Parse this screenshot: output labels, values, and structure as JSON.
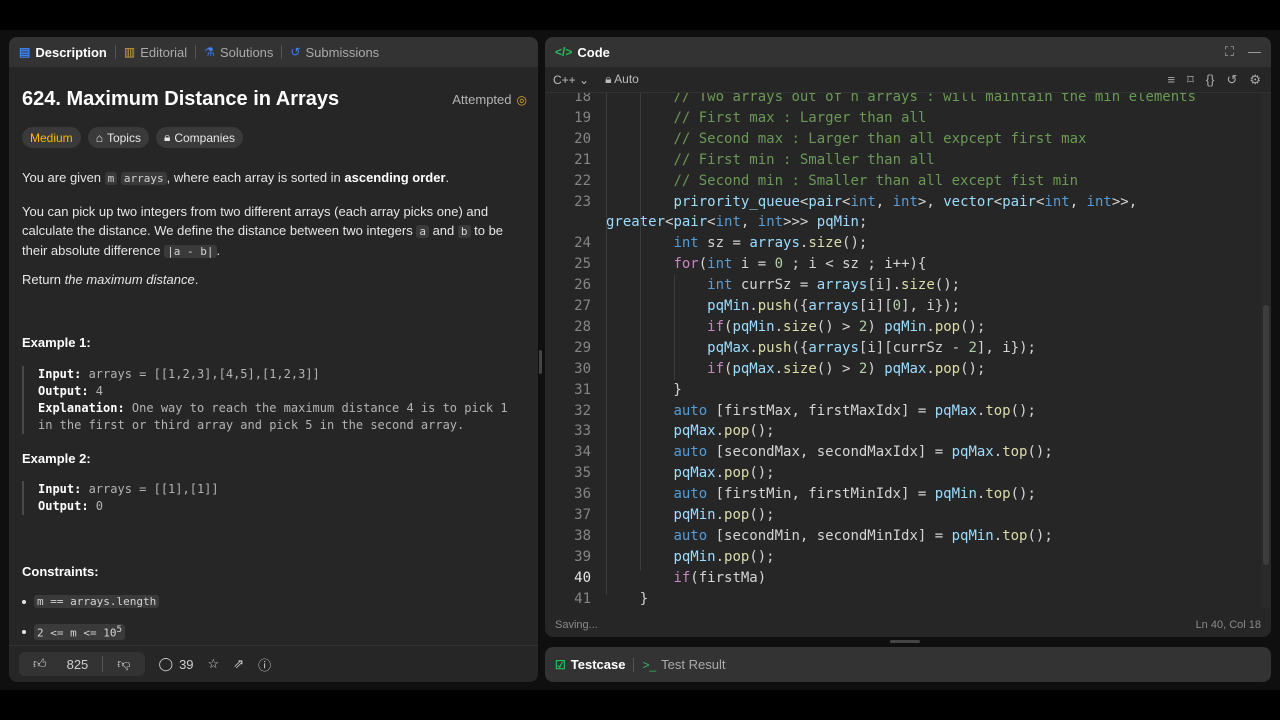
{
  "left_tabs": [
    {
      "label": "Description",
      "icon": "description-icon"
    },
    {
      "label": "Editorial",
      "icon": "book-icon"
    },
    {
      "label": "Solutions",
      "icon": "flask-icon"
    },
    {
      "label": "Submissions",
      "icon": "history-icon"
    }
  ],
  "problem": {
    "title": "624. Maximum Distance in Arrays",
    "status": "Attempted",
    "difficulty": "Medium",
    "topics_label": "Topics",
    "companies_label": "Companies",
    "p1_a": "You are given ",
    "p1_code": "m",
    "p1_b": " ",
    "p1_code2": "arrays",
    "p1_c": ", where each array is sorted in ",
    "p1_bold": "ascending order",
    "p1_d": ".",
    "p2_a": "You can pick up two integers from two different arrays (each array picks one) and calculate the distance. We define the distance between two integers ",
    "p2_code1": "a",
    "p2_b": " and ",
    "p2_code2": "b",
    "p2_c": " to be their absolute difference ",
    "p2_code3": "|a - b|",
    "p2_d": ".",
    "p3_a": "Return ",
    "p3_em": "the maximum distance",
    "p3_b": ".",
    "example1_title": "Example 1:",
    "example1_input_k": "Input:",
    "example1_input_v": " arrays = [[1,2,3],[4,5],[1,2,3]]",
    "example1_output_k": "Output:",
    "example1_output_v": " 4",
    "example1_expl_k": "Explanation:",
    "example1_expl_v1": " One way to reach the maximum distance 4 is to pick 1",
    "example1_expl_v2": "in the first or third array and pick 5 in the second array.",
    "example2_title": "Example 2:",
    "example2_input_k": "Input:",
    "example2_input_v": " arrays = [[1],[1]]",
    "example2_output_k": "Output:",
    "example2_output_v": " 0",
    "constraints_title": "Constraints:",
    "c1": "m == arrays.length",
    "c2_a": "2 <= m <= 10",
    "c2_sup": "5"
  },
  "footer": {
    "likes": "825",
    "comments": "39"
  },
  "code_panel": {
    "title": "Code",
    "language": "C++",
    "mode": "Auto",
    "status_left": "Saving...",
    "status_right": "Ln 40, Col 18"
  },
  "code_lines": [
    {
      "n": "18",
      "text": "        // Two arrays out of n arrays : will maintain the min elements"
    },
    {
      "n": "19",
      "text": "        // First max : Larger than all"
    },
    {
      "n": "20",
      "text": "        // Second max : Larger than all expcept first max"
    },
    {
      "n": "21",
      "text": "        // First min : Smaller than all"
    },
    {
      "n": "22",
      "text": "        // Second min : Smaller than all except fist min"
    },
    {
      "n": "23",
      "text": "        prirority_queue<pair<int, int>, vector<pair<int, int>>,"
    },
    {
      "n": "",
      "text": "greater<pair<int, int>>> pqMin;"
    },
    {
      "n": "24",
      "text": "        int sz = arrays.size();"
    },
    {
      "n": "25",
      "text": "        for(int i = 0 ; i < sz ; i++){"
    },
    {
      "n": "26",
      "text": "            int currSz = arrays[i].size();"
    },
    {
      "n": "27",
      "text": "            pqMin.push({arrays[i][0], i});"
    },
    {
      "n": "28",
      "text": "            if(pqMin.size() > 2) pqMin.pop();"
    },
    {
      "n": "29",
      "text": "            pqMax.push({arrays[i][currSz - 2], i});"
    },
    {
      "n": "30",
      "text": "            if(pqMax.size() > 2) pqMax.pop();"
    },
    {
      "n": "31",
      "text": "        }"
    },
    {
      "n": "32",
      "text": "        auto [firstMax, firstMaxIdx] = pqMax.top();"
    },
    {
      "n": "33",
      "text": "        pqMax.pop();"
    },
    {
      "n": "34",
      "text": "        auto [secondMax, secondMaxIdx] = pqMax.top();"
    },
    {
      "n": "35",
      "text": "        pqMax.pop();"
    },
    {
      "n": "36",
      "text": "        auto [firstMin, firstMinIdx] = pqMin.top();"
    },
    {
      "n": "37",
      "text": "        pqMin.pop();"
    },
    {
      "n": "38",
      "text": "        auto [secondMin, secondMinIdx] = pqMin.top();"
    },
    {
      "n": "39",
      "text": "        pqMin.pop();"
    },
    {
      "n": "40",
      "text": "        if(firstMa)"
    },
    {
      "n": "41",
      "text": "    }"
    }
  ],
  "bottom_tabs": [
    {
      "label": "Testcase"
    },
    {
      "label": "Test Result"
    }
  ]
}
